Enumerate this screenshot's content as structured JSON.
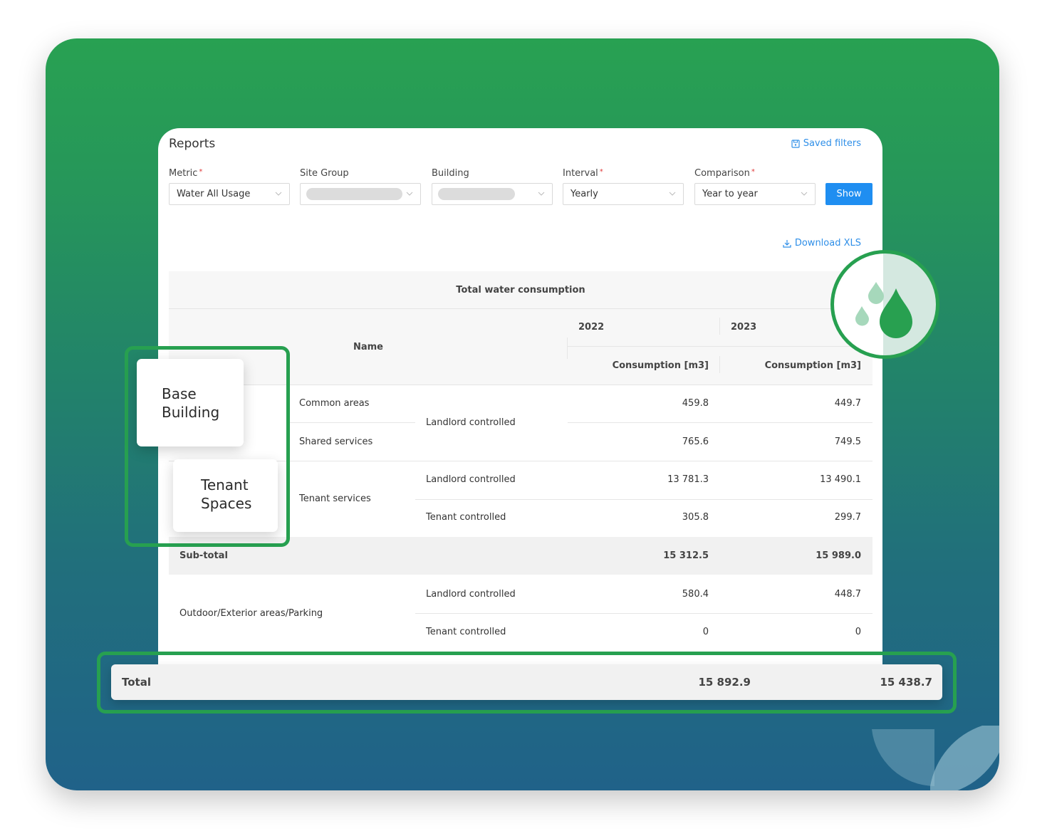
{
  "page": {
    "title": "Reports",
    "saved_filters_label": "Saved filters",
    "download_label": "Download XLS",
    "show_label": "Show"
  },
  "filters": [
    {
      "label": "Metric",
      "required": true,
      "value": "Water All Usage",
      "redacted": false
    },
    {
      "label": "Site Group",
      "required": false,
      "value": "",
      "redacted": true
    },
    {
      "label": "Building",
      "required": false,
      "value": "",
      "redacted": true
    },
    {
      "label": "Interval",
      "required": true,
      "value": "Yearly",
      "redacted": false
    },
    {
      "label": "Comparison",
      "required": true,
      "value": "Year to year",
      "redacted": false
    }
  ],
  "required_mark": "*",
  "table": {
    "title": "Total water consumption",
    "name_header": "Name",
    "years": [
      "2022",
      "2023"
    ],
    "column_header": "Consumption [m3]",
    "rows": [
      {
        "group": "Common areas",
        "control": "Landlord controlled",
        "v2022": "459.8",
        "v2023": "449.7"
      },
      {
        "group": "Shared services",
        "control": "Landlord controlled",
        "v2022": "765.6",
        "v2023": "749.5"
      },
      {
        "group": "Tenant services",
        "control": "Landlord controlled",
        "v2022": "13 781.3",
        "v2023": "13 490.1"
      },
      {
        "group": "Tenant services",
        "control": "Tenant controlled",
        "v2022": "305.8",
        "v2023": "299.7"
      }
    ],
    "subtotal": {
      "label": "Sub-total",
      "v2022": "15 312.5",
      "v2023": "15 989.0"
    },
    "outdoor": {
      "label": "Outdoor/Exterior areas/Parking",
      "rows": [
        {
          "control": "Landlord controlled",
          "v2022": "580.4",
          "v2023": "448.7"
        },
        {
          "control": "Tenant controlled",
          "v2022": "0",
          "v2023": "0"
        }
      ]
    },
    "total": {
      "label": "Total",
      "v2022": "15 892.9",
      "v2023": "15 438.7"
    }
  },
  "callouts": {
    "base_building": "Base Building",
    "tenant_spaces": "Tenant Spaces"
  },
  "colors": {
    "accent_green": "#27a050",
    "link_blue": "#2f8fe8",
    "button_blue": "#1f8ef1",
    "required_red": "#e03a3a"
  }
}
